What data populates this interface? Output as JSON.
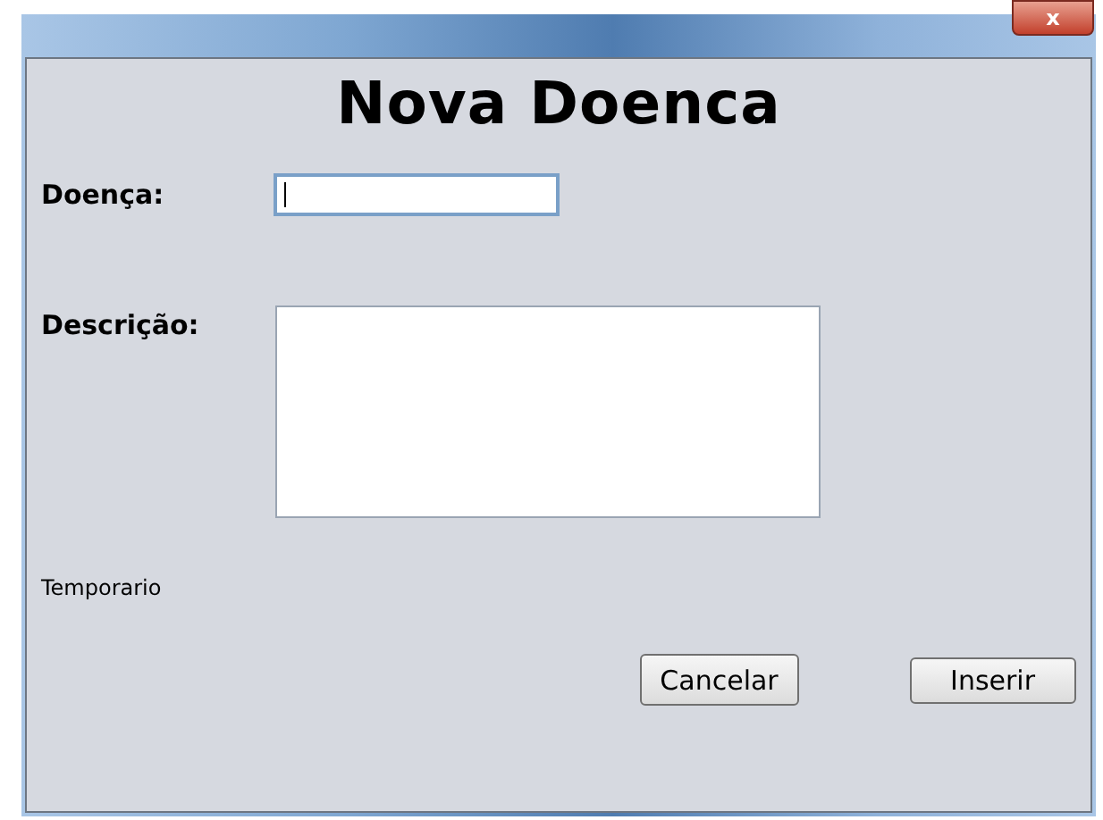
{
  "window": {
    "close_label": "x"
  },
  "heading": "Nova Doenca",
  "fields": [
    {
      "label": "Doença:",
      "kind": "input",
      "focused": true
    },
    {
      "label": "Descrição:",
      "kind": "textarea",
      "focused": false
    }
  ],
  "note": "Temporario",
  "buttons": [
    "Cancelar",
    "Inserir"
  ]
}
